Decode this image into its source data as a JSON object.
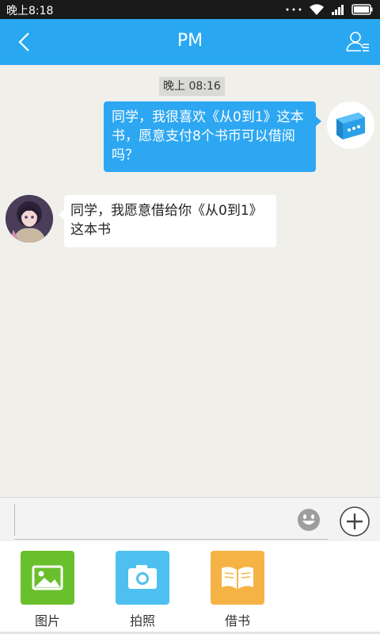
{
  "status_bar": {
    "time": "晚上8:18"
  },
  "header": {
    "title": "PM"
  },
  "chat": {
    "timestamp": "晚上 08:16",
    "messages": [
      {
        "side": "right",
        "text": "同学，我很喜欢《从0到1》这本书，愿意支付8个书币可以借阅吗？"
      },
      {
        "side": "left",
        "text": "同学，我愿意借给你《从0到1》这本书"
      }
    ]
  },
  "input": {
    "value": "",
    "placeholder": ""
  },
  "panel": {
    "items": [
      {
        "label": "图片",
        "color": "#6abf2d",
        "icon": "picture-icon"
      },
      {
        "label": "拍照",
        "color": "#4ec0f0",
        "icon": "camera-icon"
      },
      {
        "label": "借书",
        "color": "#f5b345",
        "icon": "book-icon"
      }
    ]
  },
  "colors": {
    "header": "#29a8f1",
    "bubble_right": "#2ea7f2",
    "chat_bg": "#f0efea"
  }
}
